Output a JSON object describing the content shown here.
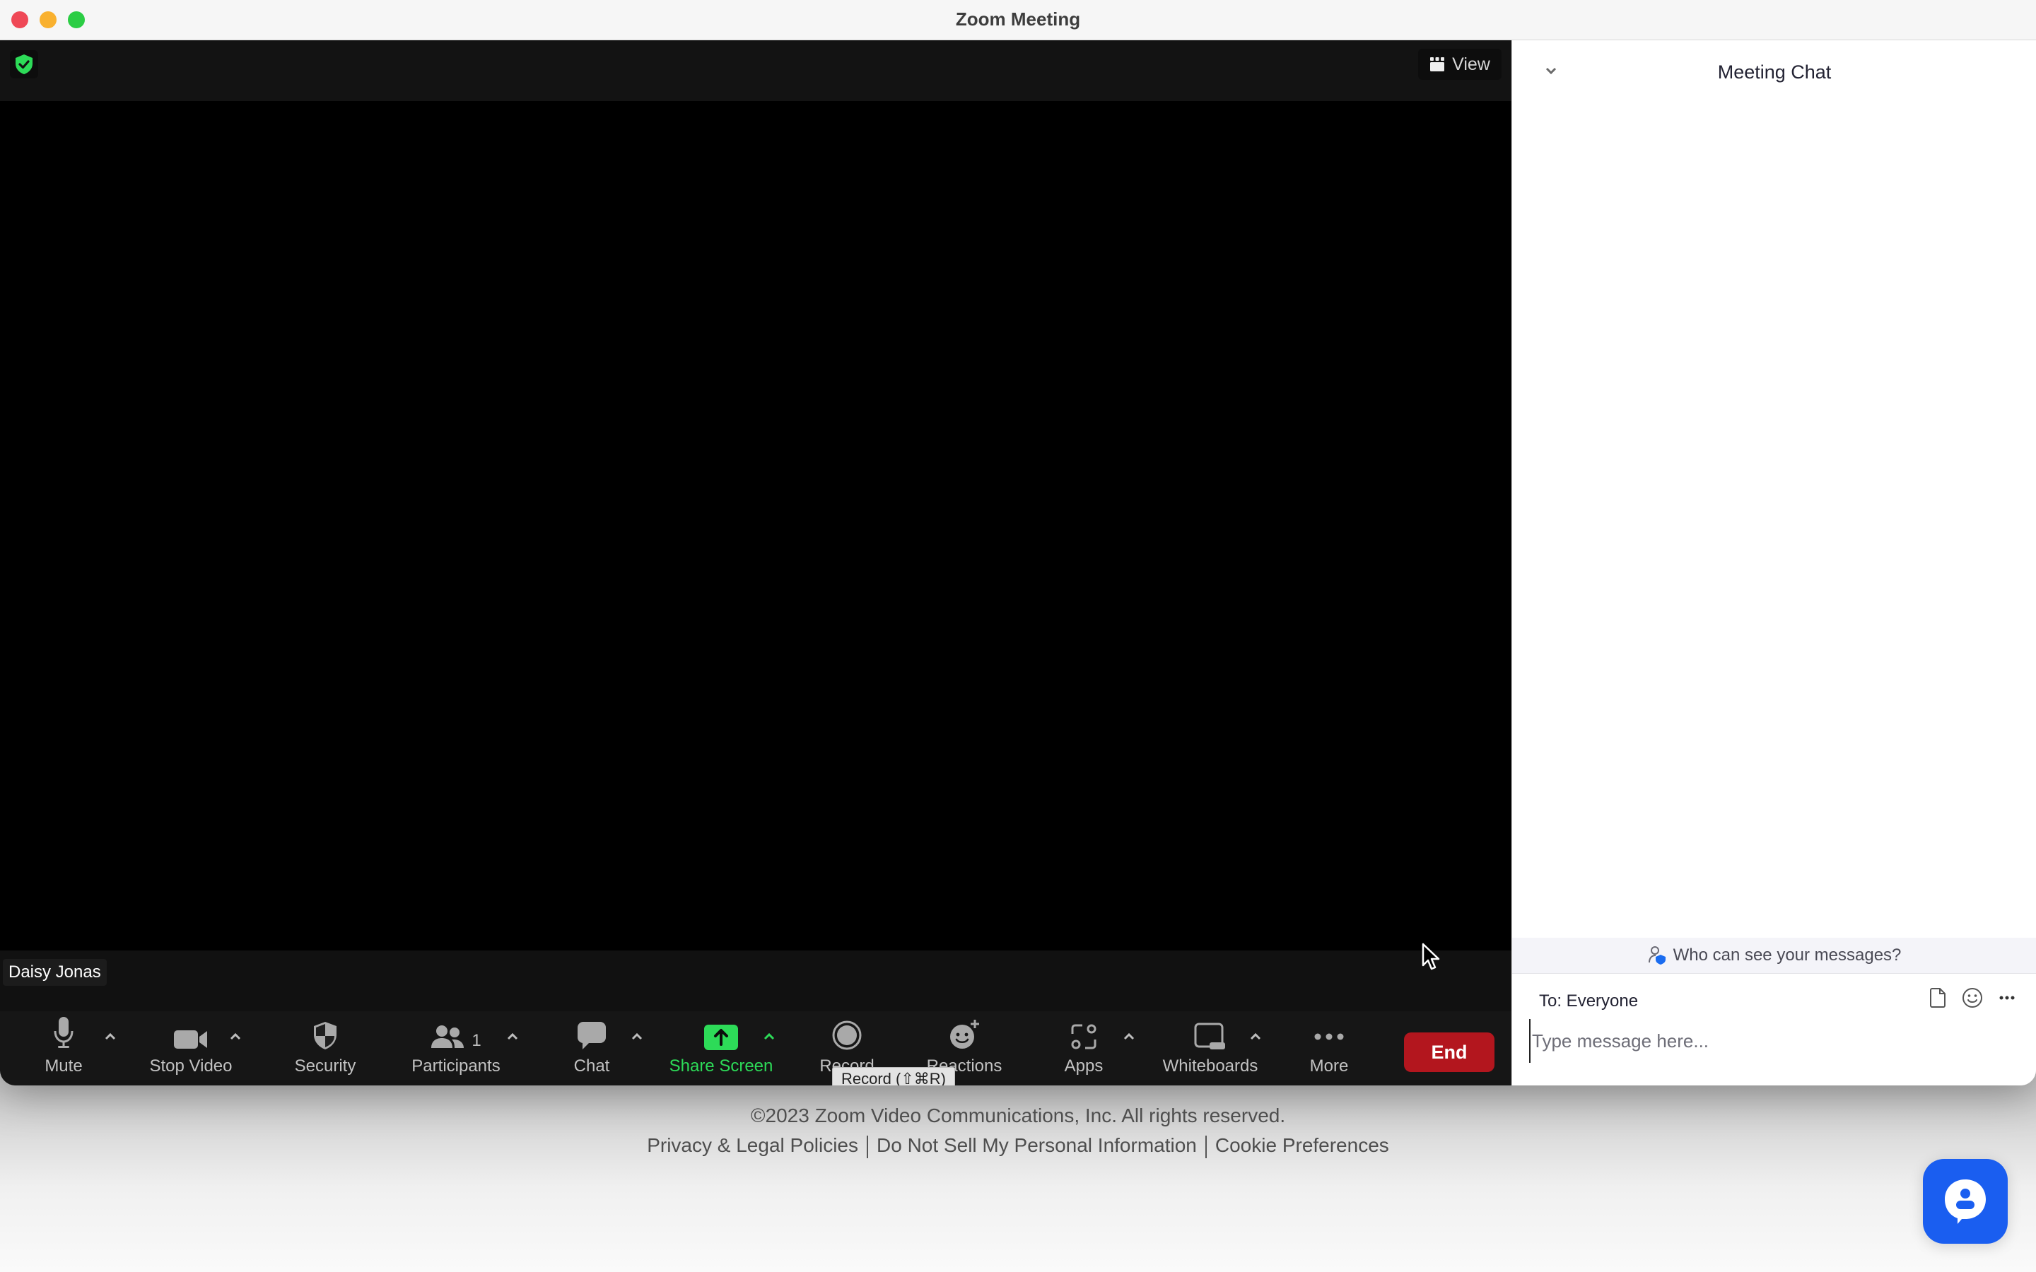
{
  "window": {
    "title": "Zoom Meeting"
  },
  "meeting": {
    "encryption_icon": "green-shield-check-icon",
    "view_label": "View",
    "participant_name": "Daisy Jonas"
  },
  "toolbar": {
    "items": [
      {
        "label": "Mute",
        "icon": "microphone-icon",
        "has_caret": true
      },
      {
        "label": "Stop Video",
        "icon": "video-camera-icon",
        "has_caret": true
      },
      {
        "label": "Security",
        "icon": "security-shield-icon",
        "has_caret": false
      },
      {
        "label": "Participants",
        "icon": "participants-icon",
        "count": "1",
        "has_caret": true
      },
      {
        "label": "Chat",
        "icon": "chat-bubble-icon",
        "has_caret": true
      },
      {
        "label": "Share Screen",
        "icon": "share-screen-icon",
        "has_caret": true,
        "active": true
      },
      {
        "label": "Record",
        "icon": "record-icon",
        "has_caret": false
      },
      {
        "label": "Reactions",
        "icon": "reactions-icon",
        "has_caret": false
      },
      {
        "label": "Apps",
        "icon": "apps-icon",
        "has_caret": true
      },
      {
        "label": "Whiteboards",
        "icon": "whiteboard-icon",
        "has_caret": true
      },
      {
        "label": "More",
        "icon": "more-dots-icon",
        "has_caret": false
      }
    ],
    "end_label": "End",
    "tooltip": "Record (⇧⌘R)",
    "accent_green": "#2ddb58",
    "end_color": "#b3161e"
  },
  "chat": {
    "title": "Meeting Chat",
    "who_can_see": "Who can see your messages?",
    "to_label": "To: Everyone",
    "input_value": "",
    "input_placeholder": "Type message here..."
  },
  "footer": {
    "copyright": "©2023 Zoom Video Communications, Inc. All rights reserved.",
    "links": [
      "Privacy & Legal Policies",
      "Do Not Sell My Personal Information",
      "Cookie Preferences"
    ]
  },
  "support": {
    "icon": "support-chat-icon",
    "color": "#1a5ef0"
  }
}
